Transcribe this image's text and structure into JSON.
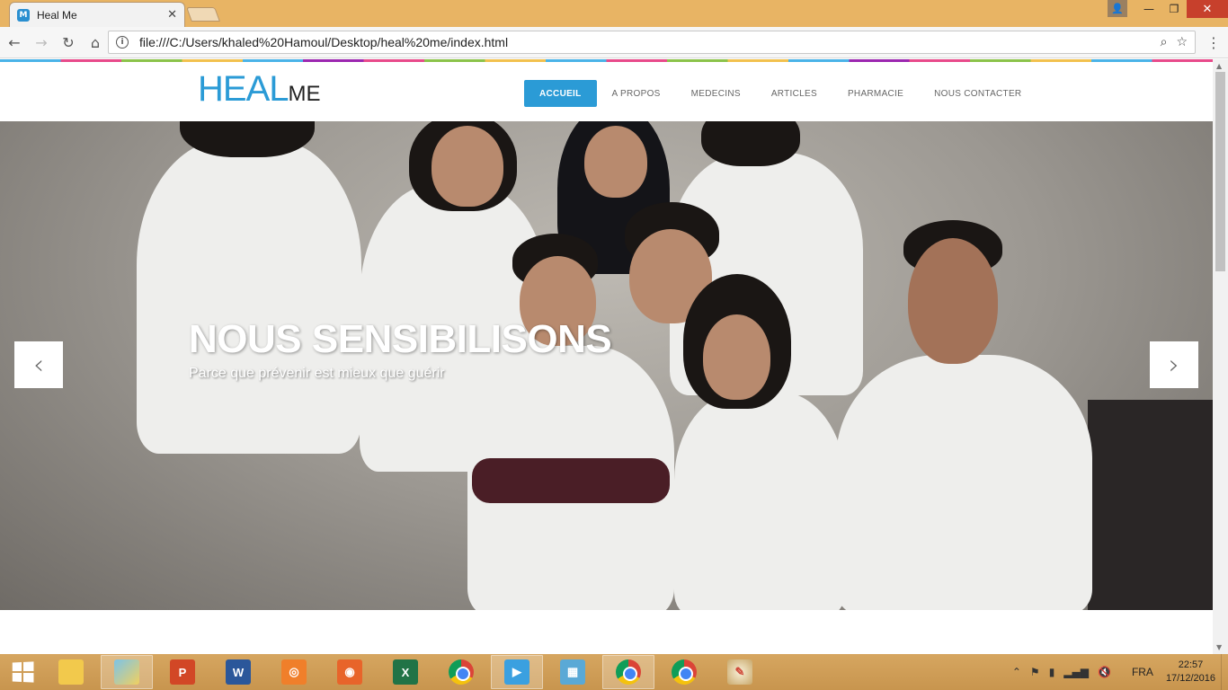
{
  "browser": {
    "tab_title": "Heal Me",
    "favicon_letter": "M",
    "url": "file:///C:/Users/khaled%20Hamoul/Desktop/heal%20me/index.html"
  },
  "site": {
    "logo_main": "HEAL",
    "logo_small": "ME",
    "accent_color": "#2b9bd6",
    "nav": [
      {
        "label": "ACCUEIL",
        "active": true
      },
      {
        "label": "A PROPOS",
        "active": false
      },
      {
        "label": "MEDECINS",
        "active": false
      },
      {
        "label": "ARTICLES",
        "active": false
      },
      {
        "label": "PHARMACIE",
        "active": false
      },
      {
        "label": "NOUS CONTACTER",
        "active": false
      }
    ]
  },
  "hero": {
    "title": "NOUS SENSIBILISONS",
    "subtitle": "Parce que prévenir est mieux que guérir",
    "prev_icon": "chevron-left-icon",
    "next_icon": "chevron-right-icon"
  },
  "taskbar": {
    "apps": [
      {
        "name": "file-explorer-icon"
      },
      {
        "name": "photos-icon"
      },
      {
        "name": "powerpoint-icon",
        "letter": "P"
      },
      {
        "name": "word-icon",
        "letter": "W"
      },
      {
        "name": "snipping-tool-icon"
      },
      {
        "name": "camera-icon"
      },
      {
        "name": "excel-icon",
        "letter": "X"
      },
      {
        "name": "chrome-icon"
      },
      {
        "name": "media-player-icon"
      },
      {
        "name": "control-panel-icon"
      },
      {
        "name": "chrome-icon-active"
      },
      {
        "name": "chrome-icon-2"
      },
      {
        "name": "paint-icon"
      }
    ],
    "language": "FRA",
    "time": "22:57",
    "date": "17/12/2016"
  }
}
